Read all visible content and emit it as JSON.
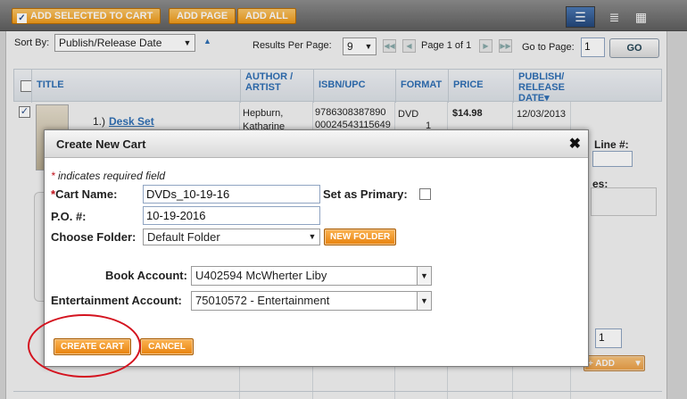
{
  "toolbar": {
    "add_selected_label": "ADD SELECTED TO CART",
    "add_page_label": "ADD PAGE",
    "add_all_label": "ADD ALL",
    "view_icons": [
      "list-view-icon",
      "detail-view-icon",
      "grid-view-icon"
    ]
  },
  "controls": {
    "sort_label": "Sort By:",
    "sort_value": "Publish/Release Date",
    "results_label": "Results Per Page:",
    "results_value": "9",
    "page_status": "Page 1 of 1",
    "goto_label": "Go to Page:",
    "goto_value": "1",
    "go_label": "GO"
  },
  "table": {
    "headers": {
      "title": "TITLE",
      "author": "AUTHOR / ARTIST",
      "isbn": "ISBN/UPC",
      "format": "FORMAT",
      "price": "PRICE",
      "publish": "PUBLISH/ RELEASE DATE▾"
    },
    "row": {
      "index": "1.)",
      "title": "Desk Set",
      "author": "Hepburn, Katharine",
      "isbn_1": "9786308387890",
      "isbn_2": "00024543115649",
      "format": "DVD",
      "format_count": "1",
      "price": "$14.98",
      "date": "12/03/2013"
    },
    "side": {
      "line_label": "Line #:",
      "notes_label": "es:",
      "qty_value": "1",
      "add_label": "+ ADD"
    }
  },
  "modal": {
    "title": "Create New Cart",
    "required_note": "indicates required field",
    "required_star": "*",
    "cart_name_label": "Cart Name:",
    "cart_name_value": "DVDs_10-19-16",
    "primary_label": "Set as Primary:",
    "po_label": "P.O. #:",
    "po_value": "10-19-2016",
    "folder_label": "Choose Folder:",
    "folder_value": "Default Folder",
    "new_folder_label": "NEW FOLDER",
    "book_account_label": "Book Account:",
    "book_account_value": "U402594 McWherter Liby",
    "ent_account_label": "Entertainment Account:",
    "ent_account_value": "75010572 - Entertainment",
    "create_label": "CREATE CART",
    "cancel_label": "CANCEL",
    "close_glyph": "✖"
  },
  "colors": {
    "accent_orange": "#ef9a1a",
    "link_blue": "#2f6fb5",
    "highlight_red": "#d4131f",
    "toolbar_gray": "#6e6e6e"
  }
}
